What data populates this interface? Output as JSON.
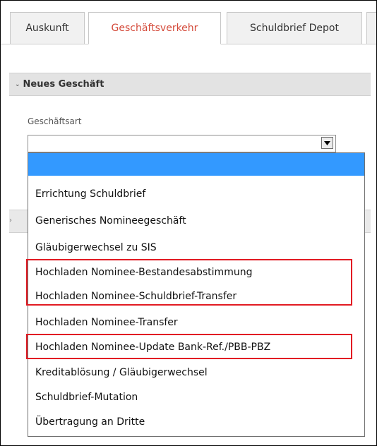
{
  "tabs": [
    {
      "label": "Auskunft",
      "active": false
    },
    {
      "label": "Geschäftsverkehr",
      "active": true
    },
    {
      "label": "Schuldbrief Depot",
      "active": false
    }
  ],
  "section": {
    "title": "Neues Geschäft"
  },
  "form": {
    "field_label": "Geschäftsart",
    "selected_value": ""
  },
  "dropdown": {
    "options": [
      "",
      "Errichtung Schuldbrief",
      "Generisches Nomineegeschäft",
      "Gläubigerwechsel zu SIS",
      "Hochladen Nominee-Bestandesabstimmung",
      "Hochladen Nominee-Schuldbrief-Transfer",
      "Hochladen Nominee-Transfer",
      "Hochladen Nominee-Update Bank-Ref./PBB-PBZ",
      "Kreditablösung / Gläubigerwechsel",
      "Schuldbrief-Mutation",
      "Übertragung an Dritte"
    ]
  },
  "colors": {
    "active_tab_text": "#d44a3a",
    "highlight": "#3399ff",
    "annotation": "#e21b23"
  }
}
